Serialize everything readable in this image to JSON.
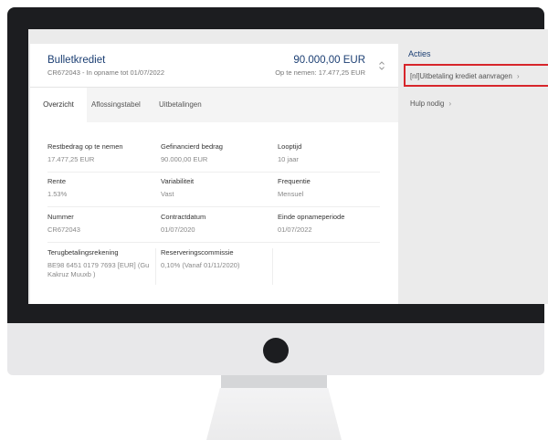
{
  "credit": {
    "title": "Bulletkrediet",
    "subtitle": "CR672043 - In opname tot 01/07/2022",
    "amount": "90.000,00 EUR",
    "available": "Op te nemen: 17.477,25 EUR"
  },
  "tabs": [
    {
      "label": "Overzicht",
      "active": true
    },
    {
      "label": "Aflossingstabel",
      "active": false
    },
    {
      "label": "Uitbetalingen",
      "active": false
    }
  ],
  "details": [
    [
      {
        "label": "Restbedrag op te nemen",
        "value": "17.477,25 EUR"
      },
      {
        "label": "Gefinancierd bedrag",
        "value": "90.000,00 EUR"
      },
      {
        "label": "Looptijd",
        "value": "10 jaar"
      }
    ],
    [
      {
        "label": "Rente",
        "value": "1.53%"
      },
      {
        "label": "Variabiliteit",
        "value": "Vast"
      },
      {
        "label": "Frequentie",
        "value": "Mensuel"
      }
    ],
    [
      {
        "label": "Nummer",
        "value": "CR672043"
      },
      {
        "label": "Contractdatum",
        "value": "01/07/2020"
      },
      {
        "label": "Einde opnameperiode",
        "value": "01/07/2022"
      }
    ],
    [
      {
        "label": "Terugbetalingsrekening",
        "value": "BE98 6451 0179 7693 [EUR] (Gu",
        "value2": "Kakruz Muuxb )"
      },
      {
        "label": "Reserveringscommissie",
        "value": "0,10% (Vanaf 01/11/2020)"
      }
    ]
  ],
  "actions": {
    "title": "Acties",
    "items": [
      {
        "label": "[nl]Uitbetaling krediet aanvragen",
        "chevron": "›"
      },
      {
        "label": "Hulp nodig",
        "chevron": "›"
      }
    ]
  },
  "colors": {
    "brand": "#1c3f73",
    "highlight": "#d7262b"
  }
}
